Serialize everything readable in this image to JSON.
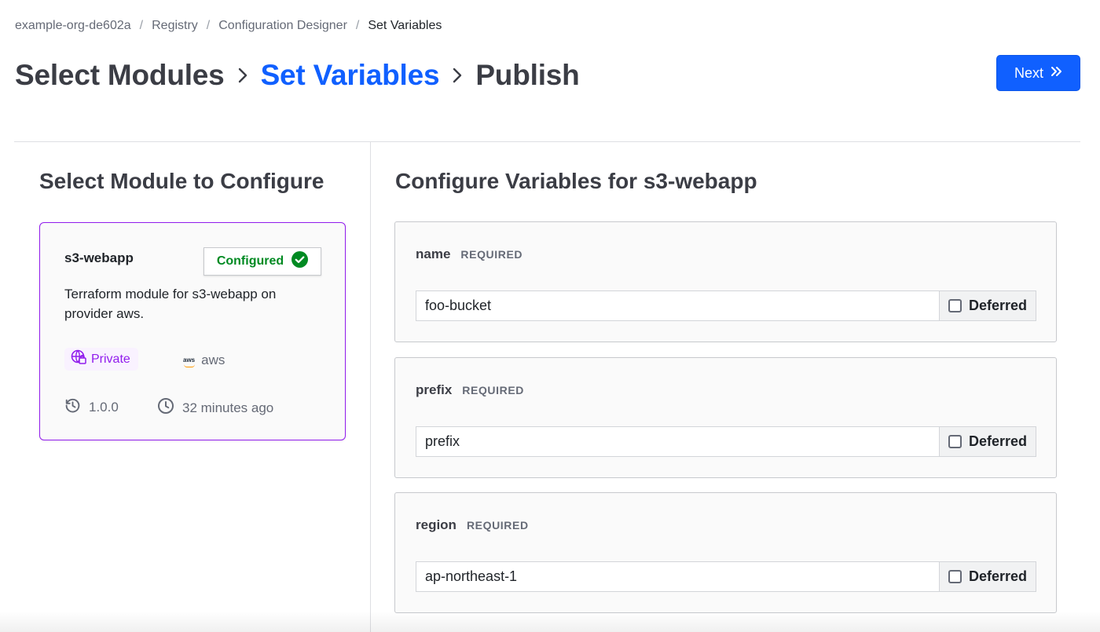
{
  "breadcrumb": {
    "items": [
      {
        "label": "example-org-de602a"
      },
      {
        "label": "Registry"
      },
      {
        "label": "Configuration Designer"
      },
      {
        "label": "Set Variables"
      }
    ],
    "separator": "/"
  },
  "wizard": {
    "steps": [
      {
        "label": "Select Modules",
        "state": "done"
      },
      {
        "label": "Set Variables",
        "state": "active"
      },
      {
        "label": "Publish",
        "state": "pending"
      }
    ],
    "next_label": "Next",
    "next_icon": "chevrons-right-icon"
  },
  "left_panel": {
    "title": "Select Module to Configure",
    "module": {
      "name": "s3-webapp",
      "status_label": "Configured",
      "status_icon": "check-circle-icon",
      "description": "Terraform module for s3-webapp on provider aws.",
      "visibility_label": "Private",
      "visibility_icon": "globe-lock-icon",
      "provider_logo_text": "aws",
      "provider": "aws",
      "version": "1.0.0",
      "version_icon": "history-icon",
      "updated": "32 minutes ago",
      "updated_icon": "clock-icon"
    }
  },
  "right_panel": {
    "title": "Configure Variables for s3-webapp",
    "required_label": "REQUIRED",
    "deferred_label": "Deferred",
    "variables": [
      {
        "name": "name",
        "value": "foo-bucket",
        "deferred": false
      },
      {
        "name": "prefix",
        "value": "prefix",
        "deferred": false
      },
      {
        "name": "region",
        "value": "ap-northeast-1",
        "deferred": false
      }
    ]
  },
  "colors": {
    "accent": "#1060ff",
    "module_border": "#911ced",
    "success": "#008a22",
    "text_muted": "#656a76"
  }
}
